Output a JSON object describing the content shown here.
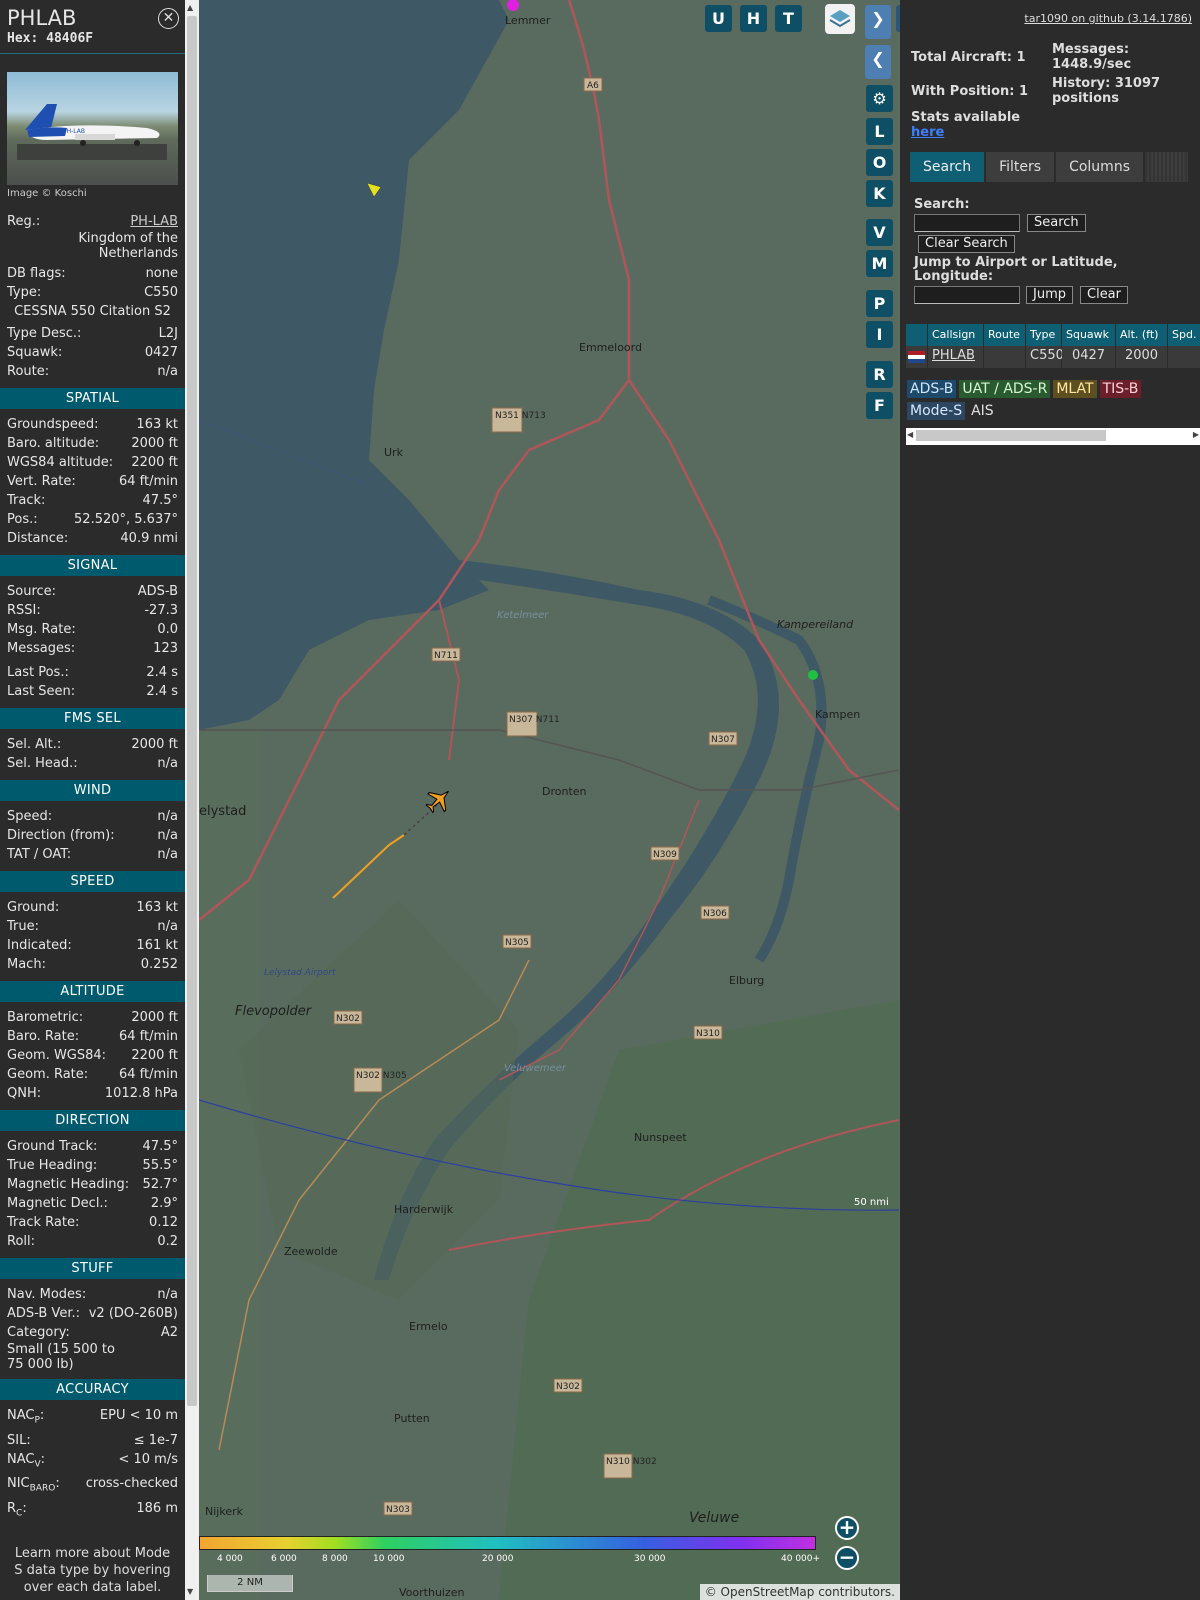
{
  "sidebar": {
    "callsign": "PHLAB",
    "hex": "Hex: 48406F",
    "image_credit": "Image © Koschi",
    "photo_reg": "PH-LAB",
    "reg_label": "Reg.:",
    "reg_value": "PH-LAB",
    "country": "Kingdom of the Netherlands",
    "db_flags_label": "DB flags:",
    "db_flags_value": "none",
    "type_label": "Type:",
    "type_value": "C550",
    "type_name": "CESSNA 550 Citation S2",
    "typedesc_label": "Type Desc.:",
    "typedesc_value": "L2J",
    "squawk_label": "Squawk:",
    "squawk_value": "0427",
    "route_label": "Route:",
    "route_value": "n/a",
    "spatial": {
      "title": "SPATIAL",
      "rows": [
        {
          "label": "Groundspeed:",
          "value": "163 kt"
        },
        {
          "label": "Baro. altitude:",
          "value": "2000 ft"
        },
        {
          "label": "WGS84 altitude:",
          "value": "2200 ft"
        },
        {
          "label": "Vert. Rate:",
          "value": "64 ft/min"
        },
        {
          "label": "Track:",
          "value": "47.5°"
        },
        {
          "label": "Pos.:",
          "value": "52.520°, 5.637°"
        },
        {
          "label": "Distance:",
          "value": "40.9 nmi"
        }
      ]
    },
    "signal": {
      "title": "SIGNAL",
      "rows": [
        {
          "label": "Source:",
          "value": "ADS-B"
        },
        {
          "label": "RSSI:",
          "value": "-27.3"
        },
        {
          "label": "Msg. Rate:",
          "value": "0.0"
        },
        {
          "label": "Messages:",
          "value": "123"
        },
        {
          "label": "Last Pos.:",
          "value": "2.4 s"
        },
        {
          "label": "Last Seen:",
          "value": "2.4 s"
        }
      ]
    },
    "fms": {
      "title": "FMS SEL",
      "rows": [
        {
          "label": "Sel. Alt.:",
          "value": "2000 ft"
        },
        {
          "label": "Sel. Head.:",
          "value": "n/a"
        }
      ]
    },
    "wind": {
      "title": "WIND",
      "rows": [
        {
          "label": "Speed:",
          "value": "n/a"
        },
        {
          "label": "Direction (from):",
          "value": "n/a"
        },
        {
          "label": "TAT / OAT:",
          "value": "n/a"
        }
      ]
    },
    "speed": {
      "title": "SPEED",
      "rows": [
        {
          "label": "Ground:",
          "value": "163 kt"
        },
        {
          "label": "True:",
          "value": "n/a"
        },
        {
          "label": "Indicated:",
          "value": "161 kt"
        },
        {
          "label": "Mach:",
          "value": "0.252"
        }
      ]
    },
    "altitude": {
      "title": "ALTITUDE",
      "rows": [
        {
          "label": "Barometric:",
          "value": "2000 ft"
        },
        {
          "label": "Baro. Rate:",
          "value": "64 ft/min"
        },
        {
          "label": "Geom. WGS84:",
          "value": "2200 ft"
        },
        {
          "label": "Geom. Rate:",
          "value": "64 ft/min"
        },
        {
          "label": "QNH:",
          "value": "1012.8 hPa"
        }
      ]
    },
    "direction": {
      "title": "DIRECTION",
      "rows": [
        {
          "label": "Ground Track:",
          "value": "47.5°"
        },
        {
          "label": "True Heading:",
          "value": "55.5°"
        },
        {
          "label": "Magnetic Heading:",
          "value": "52.7°"
        },
        {
          "label": "Magnetic Decl.:",
          "value": "2.9°"
        },
        {
          "label": "Track Rate:",
          "value": "0.12"
        },
        {
          "label": "Roll:",
          "value": "0.2"
        }
      ]
    },
    "stuff": {
      "title": "STUFF",
      "rows": [
        {
          "label": "Nav. Modes:",
          "value": "n/a"
        },
        {
          "label": "ADS-B Ver.:",
          "value": "v2 (DO-260B)"
        },
        {
          "label": "Category:",
          "value": "A2"
        }
      ],
      "category_desc": "Small (15 500 to 75 000 lb)"
    },
    "accuracy": {
      "title": "ACCURACY",
      "nacp_label": "NAC",
      "nacp_sub": "P",
      "nacp_value": "EPU < 10 m",
      "sil_label": "SIL:",
      "sil_value": "≤ 1e-7",
      "nacv_label": "NAC",
      "nacv_sub": "V",
      "nacv_value": "< 10 m/s",
      "nicbaro_label": "NIC",
      "nicbaro_sub": "BARO",
      "nicbaro_value": "cross-checked",
      "rc_label": "R",
      "rc_sub": "C",
      "rc_value": "186 m"
    },
    "footer_text": "Learn more about Mode S data type by hovering over each data label."
  },
  "map": {
    "buttons": [
      "U",
      "H",
      "T"
    ],
    "side_buttons": [
      "L",
      "O",
      "K",
      "V",
      "M",
      "P",
      "I",
      "R",
      "F"
    ],
    "places": [
      {
        "name": "Lemmer"
      },
      {
        "name": "Emmeloord"
      },
      {
        "name": "Urk"
      },
      {
        "name": "Dronten"
      },
      {
        "name": "Kampen"
      },
      {
        "name": "Kampereiland"
      },
      {
        "name": "Elburg"
      },
      {
        "name": "Nunspeet"
      },
      {
        "name": "Harderwijk"
      },
      {
        "name": "Zeewolde"
      },
      {
        "name": "Ermelo"
      },
      {
        "name": "Putten"
      },
      {
        "name": "Nijkerk"
      },
      {
        "name": "Flevopolder"
      },
      {
        "name": "Veluwe"
      },
      {
        "name": "Voorthuizen"
      },
      {
        "name": "elystad"
      },
      {
        "name": "Ketelmeer"
      },
      {
        "name": "Veluwemeer"
      },
      {
        "name": "Lelystad Airport"
      }
    ],
    "road_labels": [
      "A6",
      "N351 N713",
      "N711",
      "N307 N711",
      "N307",
      "N309",
      "N306",
      "N305",
      "N302",
      "N310",
      "N302 N305",
      "N303",
      "N310 N302",
      "N302"
    ],
    "range_label": "50 nmi",
    "legend_ticks": [
      "4 000",
      "6 000",
      "8 000",
      "10 000",
      "20 000",
      "30 000",
      "40 000+"
    ],
    "scale_label": "2 NM",
    "attribution": "© OpenStreetMap contributors.",
    "zoom_in": "+",
    "zoom_out": "−"
  },
  "panel": {
    "github_link": "tar1090 on github (3.14.1786)",
    "total_aircraft": "Total Aircraft: 1",
    "with_position": "With Position: 1",
    "messages": "Messages: 1448.9/sec",
    "history": "History: 31097 positions",
    "stats_text": "Stats available",
    "stats_link": "here",
    "tabs": [
      "Search",
      "Filters",
      "Columns"
    ],
    "search_label": "Search:",
    "search_button": "Search",
    "clear_search_button": "Clear Search",
    "jump_label": "Jump to Airport or Latitude, Longitude:",
    "jump_button": "Jump",
    "clear_button": "Clear",
    "table": {
      "headers": [
        "",
        "Callsign",
        "Route",
        "Type",
        "Squawk",
        "Alt. (ft)",
        "Spd."
      ],
      "rows": [
        {
          "callsign": "PHLAB",
          "route": "",
          "type": "C550",
          "squawk": "0427",
          "alt": "2000",
          "spd": ""
        }
      ]
    },
    "badges": [
      {
        "label": "ADS-B",
        "bg": "#1d4a6b",
        "fg": "#cfe6ff"
      },
      {
        "label": "UAT / ADS-R",
        "bg": "#2a5a30",
        "fg": "#d8f5d0"
      },
      {
        "label": "MLAT",
        "bg": "#5e4f20",
        "fg": "#ffe6a0"
      },
      {
        "label": "TIS-B",
        "bg": "#6b1f2a",
        "fg": "#ffd0d6"
      },
      {
        "label": "Mode-S",
        "bg": "#2c4660",
        "fg": "#d6e6ff"
      },
      {
        "label": "AIS",
        "bg": "transparent",
        "fg": "#e0e0e0"
      }
    ]
  }
}
